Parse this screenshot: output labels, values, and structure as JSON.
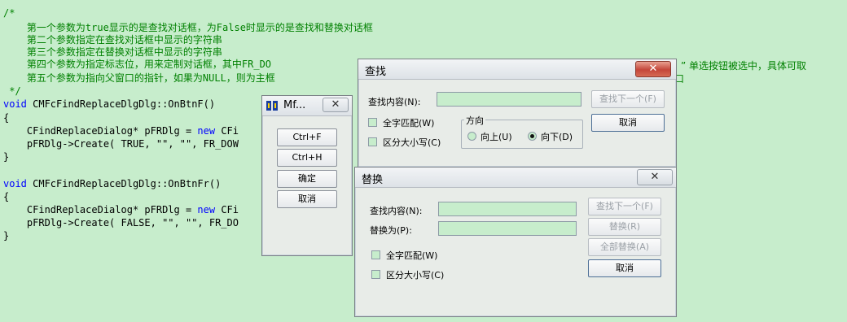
{
  "code": {
    "lines": [
      "/*",
      "    第一个参数为true显示的是查找对话框，为False时显示的是查找和替换对话框",
      "    第二个参数指定在查找对话框中显示的字符串",
      "    第三个参数指定在替换对话框中显示的字符串",
      "    第四个参数为指定标志位，用来定制对话框，其中FR_DO",
      "    第五个参数为指向父窗口的指针，如果为NULL，则为主框",
      " */",
      "void CMFcFindReplaceDlgDlg::OnBtnF()",
      "{",
      "    CFindReplaceDialog* pFRDlg = new CFi",
      "    pFRDlg->Create( TRUE, \"\", \"\", FR_DOW",
      "}",
      "",
      "void CMFcFindReplaceDlgDlg::OnBtnFr()",
      "{",
      "    CFindReplaceDialog* pFRDlg = new CFi",
      "    pFRDlg->Create( FALSE, \"\", \"\", FR_DO",
      "}"
    ],
    "overflow_line4": "” 单选按钮被选中，具体可取",
    "overflow_line5": "口"
  },
  "mf_window": {
    "title": "Mf...",
    "buttons": [
      "Ctrl+F",
      "Ctrl+H",
      "确定",
      "取消"
    ]
  },
  "find_dialog": {
    "title": "查找",
    "close": "X",
    "find_label": "查找内容(N):",
    "find_value": "",
    "find_next": "查找下一个(F)",
    "cancel": "取消",
    "match_whole": "全字匹配(W)",
    "match_case": "区分大小写(C)",
    "direction": "方向",
    "up": "向上(U)",
    "down": "向下(D)",
    "direction_selected": "down"
  },
  "replace_dialog": {
    "title": "替换",
    "close": "X",
    "find_label": "查找内容(N):",
    "replace_label": "替换为(P):",
    "find_next": "查找下一个(F)",
    "replace": "替换(R)",
    "replace_all": "全部替换(A)",
    "cancel": "取消",
    "match_whole": "全字匹配(W)",
    "match_case": "区分大小写(C)"
  },
  "colors": {
    "background": "#c7edcc",
    "comment": "#008000",
    "keyword": "#0000ff",
    "close_button": "#c4463a"
  }
}
